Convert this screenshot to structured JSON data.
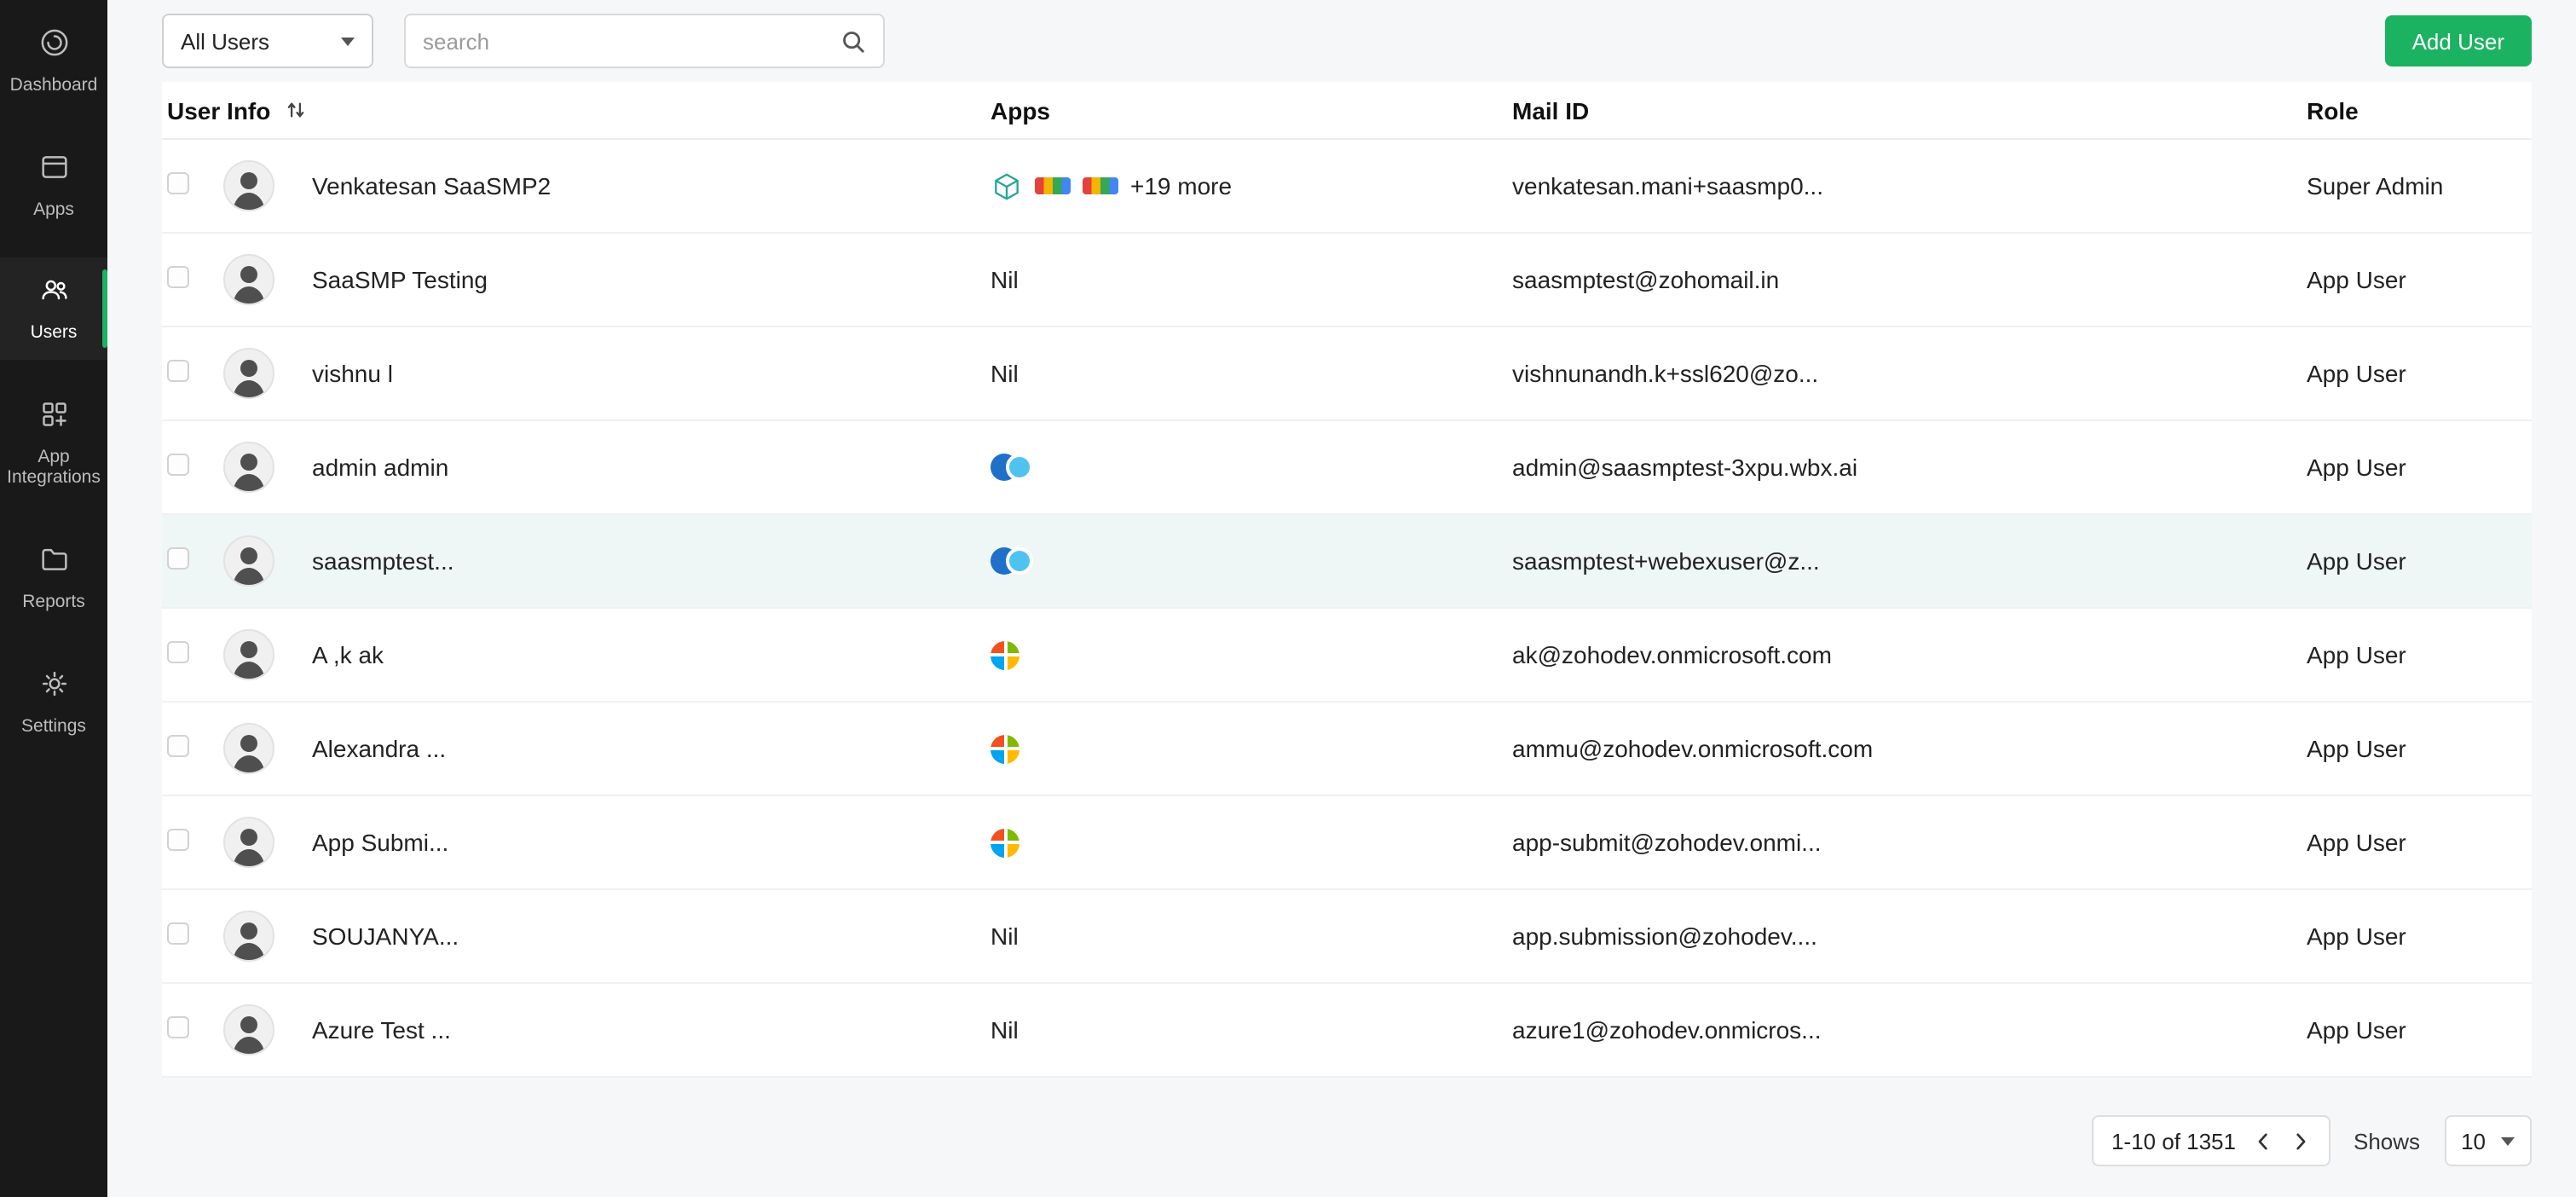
{
  "sidebar": {
    "items": [
      {
        "label": "Dashboard",
        "active": false
      },
      {
        "label": "Apps",
        "active": false
      },
      {
        "label": "Users",
        "active": true
      },
      {
        "label": "App Integrations",
        "active": false
      },
      {
        "label": "Reports",
        "active": false
      },
      {
        "label": "Settings",
        "active": false
      }
    ]
  },
  "topbar": {
    "filter_value": "All Users",
    "search_placeholder": "search",
    "add_user_label": "Add User"
  },
  "table": {
    "headers": {
      "user_info": "User Info",
      "apps": "Apps",
      "mail_id": "Mail ID",
      "role": "Role"
    },
    "nil_label": "Nil",
    "rows": [
      {
        "name": "Venkatesan SaaSMP2",
        "apps_type": "multi",
        "apps_more": "+19 more",
        "mail": "venkatesan.mani+saasmp0...",
        "role": "Super Admin"
      },
      {
        "name": "SaaSMP Testing",
        "apps_type": "nil",
        "mail": "saasmptest@zohomail.in",
        "role": "App User"
      },
      {
        "name": "vishnu l",
        "apps_type": "nil",
        "mail": "vishnunandh.k+ssl620@zo...",
        "role": "App User"
      },
      {
        "name": "admin admin",
        "apps_type": "webex",
        "mail": "admin@saasmptest-3xpu.wbx.ai",
        "role": "App User"
      },
      {
        "name": "saasmptest...",
        "apps_type": "webex",
        "mail": "saasmptest+webexuser@z...",
        "role": "App User",
        "highlighted": true
      },
      {
        "name": "A ,k ak",
        "apps_type": "microsoft",
        "mail": "ak@zohodev.onmicrosoft.com",
        "role": "App User"
      },
      {
        "name": "Alexandra ...",
        "apps_type": "microsoft",
        "mail": "ammu@zohodev.onmicrosoft.com",
        "role": "App User"
      },
      {
        "name": "App Submi...",
        "apps_type": "microsoft",
        "mail": "app-submit@zohodev.onmi...",
        "role": "App User"
      },
      {
        "name": "SOUJANYA...",
        "apps_type": "nil",
        "mail": "app.submission@zohodev....",
        "role": "App User"
      },
      {
        "name": "Azure Test ...",
        "apps_type": "nil",
        "mail": "azure1@zohodev.onmicros...",
        "role": "App User"
      }
    ]
  },
  "pagination": {
    "range": "1-10 of 1351",
    "shows_label": "Shows",
    "page_size": "10"
  },
  "colors": {
    "accent_green": "#1bb261",
    "sidebar_bg": "#191919",
    "row_highlight": "#eef7f6"
  }
}
